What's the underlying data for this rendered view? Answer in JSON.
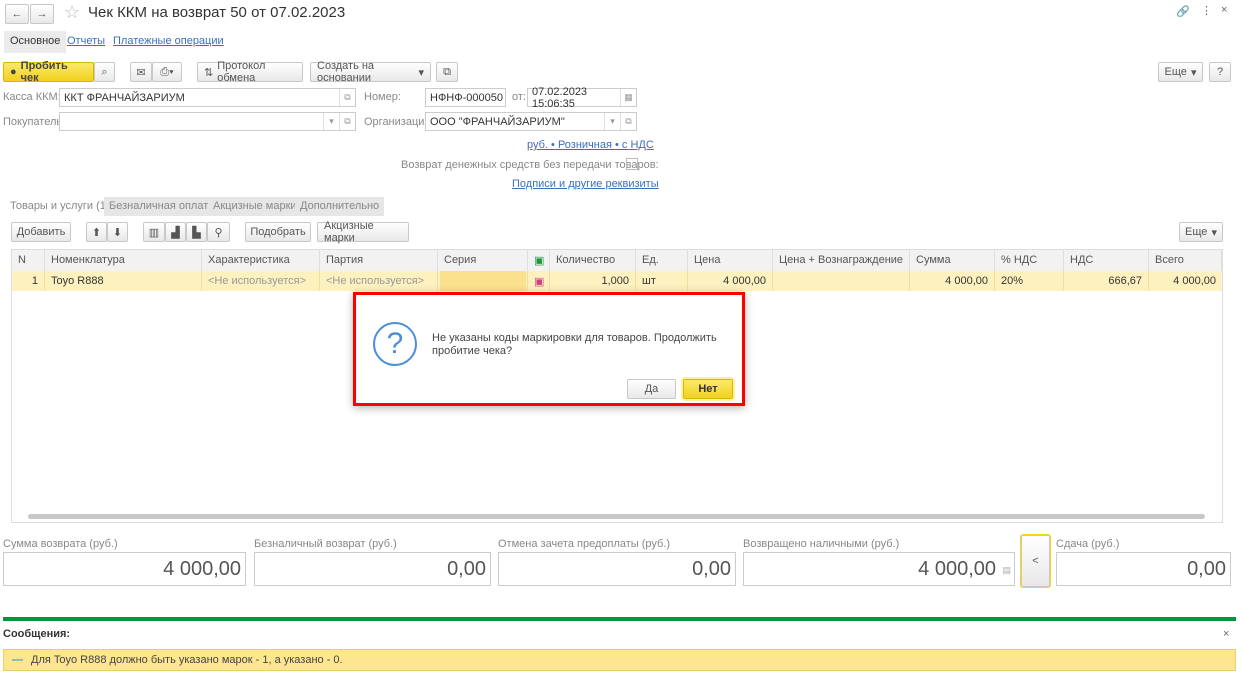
{
  "window": {
    "title": "Чек ККМ на возврат 50 от 07.02.2023"
  },
  "nav_tabs": [
    "Основное",
    "Отчеты",
    "Платежные операции"
  ],
  "toolbar": {
    "print_check": "Пробить чек",
    "exchange_log": "Протокол обмена",
    "create_based": "Создать на основании",
    "more": "Еще",
    "help": "?"
  },
  "form": {
    "kassa_label": "Касса ККМ:",
    "kassa_value": "ККТ ФРАНЧАЙЗАРИУМ",
    "buyer_label": "Покупатель:",
    "buyer_value": "",
    "number_label": "Номер:",
    "number_value": "НФНФ-000050",
    "date_label": "от:",
    "date_value": "07.02.2023 15:06:35",
    "org_label": "Организация:",
    "org_value": "ООО \"ФРАНЧАЙЗАРИУМ\"",
    "price_link": "руб. • Розничная • с НДС",
    "refund_label": "Возврат денежных средств без передачи товаров:",
    "refund_checked": false,
    "signatures_link": "Подписи и другие реквизиты"
  },
  "tabs": [
    "Товары и услуги (1)",
    "Безналичная оплата",
    "Акцизные марки",
    "Дополнительно"
  ],
  "table_toolbar": {
    "add": "Добавить",
    "pick": "Подобрать",
    "excise": "Акцизные марки",
    "more": "Еще"
  },
  "table": {
    "columns": [
      "N",
      "Номенклатура",
      "Характеристика",
      "Партия",
      "Серия",
      "",
      "Количество",
      "Ед.",
      "Цена",
      "Цена + Вознаграждение",
      "Сумма",
      "% НДС",
      "НДС",
      "Всего"
    ],
    "rows": [
      [
        "1",
        "Toyo R888",
        "<Не используется>",
        "<Не используется>",
        "",
        "",
        "1,000",
        "шт",
        "4 000,00",
        "",
        "4 000,00",
        "20%",
        "666,67",
        "4 000,00"
      ]
    ]
  },
  "dialog": {
    "message": "Не указаны коды маркировки для товаров. Продолжить пробитие чека?",
    "yes": "Да",
    "no": "Нет"
  },
  "totals": [
    {
      "label": "Сумма возврата (руб.)",
      "value": "4 000,00"
    },
    {
      "label": "Безналичный возврат (руб.)",
      "value": "0,00"
    },
    {
      "label": "Отмена зачета предоплаты (руб.)",
      "value": "0,00"
    },
    {
      "label": "Возвращено наличными (руб.)",
      "value": "4 000,00"
    },
    {
      "label": "Сдача (руб.)",
      "value": "0,00"
    }
  ],
  "messages": {
    "title": "Сообщения:",
    "items": [
      "Для Toyo R888 должно быть указано марок - 1, а указано - 0."
    ]
  },
  "colors": {
    "accent_yellow": "#f5d90a",
    "highlight_row": "#fdf1c0",
    "messages_green": "#00963c",
    "dialog_border": "#ff0000"
  }
}
